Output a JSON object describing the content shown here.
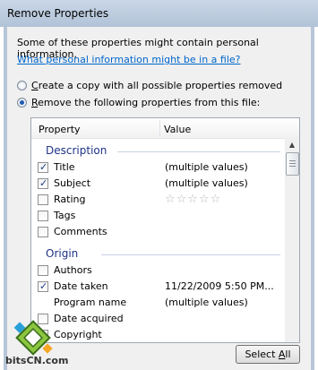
{
  "window": {
    "title": "Remove Properties"
  },
  "intro_text": "Some of these properties might contain personal information.",
  "help_link": "What personal information might be in a file?",
  "radio_copy": {
    "prefix": "",
    "accel": "C",
    "rest": "reate a copy with all possible properties removed"
  },
  "radio_remove": {
    "accel": "R",
    "rest": "emove the following properties from this file:"
  },
  "table": {
    "col_property": "Property",
    "col_value": "Value",
    "sections": [
      {
        "name": "Description",
        "rows": [
          {
            "name": "Title",
            "value": "(multiple values)",
            "checked": true,
            "checkbox": true
          },
          {
            "name": "Subject",
            "value": "(multiple values)",
            "checked": true,
            "checkbox": true
          },
          {
            "name": "Rating",
            "value": "☆☆☆☆☆",
            "checked": false,
            "checkbox": true,
            "stars": true
          },
          {
            "name": "Tags",
            "value": "",
            "checked": false,
            "checkbox": true
          },
          {
            "name": "Comments",
            "value": "",
            "checked": false,
            "checkbox": true
          }
        ]
      },
      {
        "name": "Origin",
        "rows": [
          {
            "name": "Authors",
            "value": "",
            "checked": false,
            "checkbox": true
          },
          {
            "name": "Date taken",
            "value": "11/22/2009 5:50 PM...",
            "checked": true,
            "checkbox": true
          },
          {
            "name": "Program name",
            "value": "(multiple values)",
            "checked": false,
            "checkbox": false
          },
          {
            "name": "Date acquired",
            "value": "",
            "checked": false,
            "checkbox": true
          },
          {
            "name": "Copyright",
            "value": "",
            "checked": false,
            "checkbox": true
          }
        ]
      }
    ]
  },
  "select_all": {
    "accel": "A",
    "prefix": "Select ",
    "rest": "ll"
  },
  "watermark": "bitsCN.com",
  "colors": {
    "link": "#0066cc",
    "section": "#1e3287",
    "titlebar": "#b1c3d8"
  }
}
